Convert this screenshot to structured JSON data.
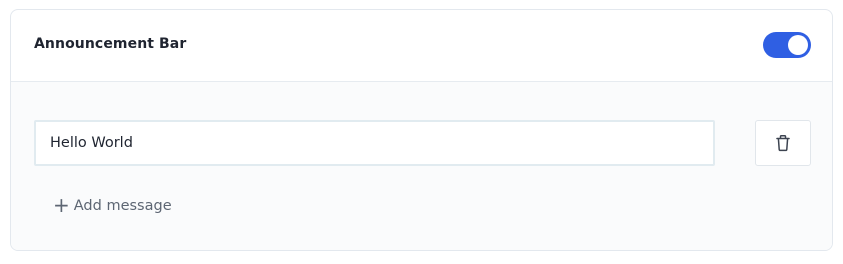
{
  "section": {
    "title": "Announcement Bar",
    "enabled": true
  },
  "messages": [
    {
      "value": "Hello World",
      "delete_icon": "trash-icon"
    }
  ],
  "actions": {
    "add_label": "Add message",
    "add_icon": "+"
  },
  "colors": {
    "toggle_on": "#2f5fe3"
  }
}
